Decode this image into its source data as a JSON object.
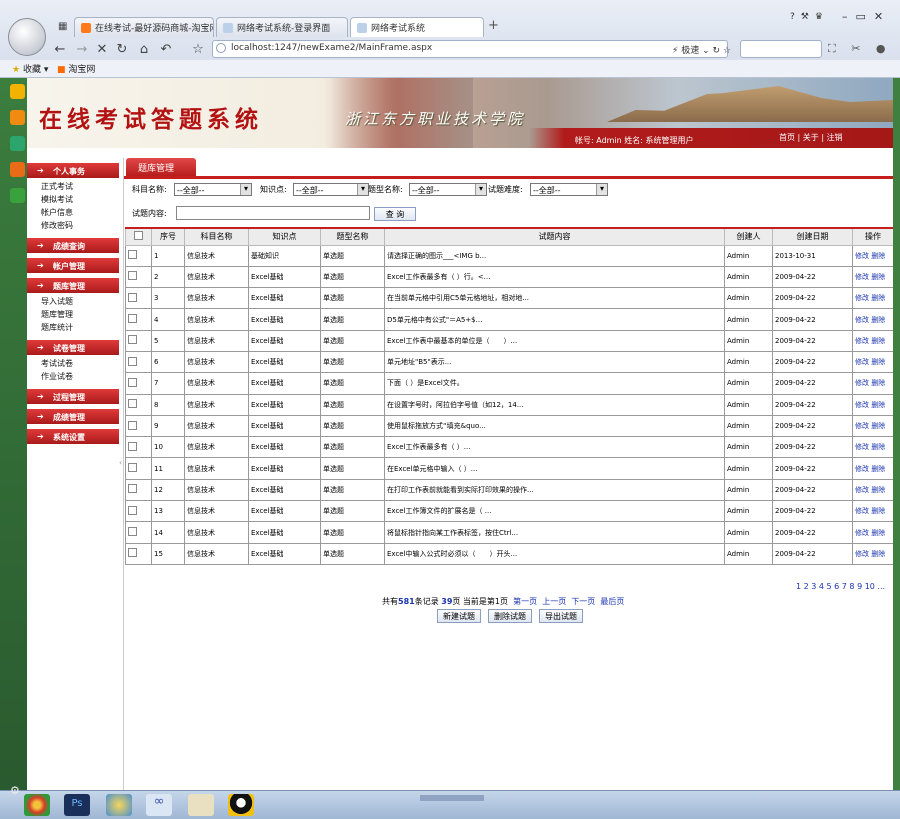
{
  "browser": {
    "tabs": [
      {
        "label": "在线考试-最好源码商城-淘宝网",
        "active": false
      },
      {
        "label": "网络考试系统-登录界面",
        "active": false
      },
      {
        "label": "网络考试系统",
        "active": true
      }
    ],
    "new_tab": "+",
    "address": "localhost:1247/newExame2/MainFrame.aspx",
    "speed_label": "极速",
    "bookmarks": [
      {
        "label": "收藏"
      },
      {
        "label": "淘宝网"
      }
    ]
  },
  "header": {
    "app_title": "在线考试答题系统",
    "school_name": "浙江东方职业技术学院",
    "user_info": "帐号: Admin 姓名: 系统管理用户",
    "links": [
      "首页",
      "关于",
      "注销"
    ]
  },
  "sidebar": {
    "groups": [
      {
        "label": "个人事务",
        "items": [
          "正式考试",
          "模拟考试",
          "帐户信息",
          "修改密码"
        ]
      },
      {
        "label": "成绩查询",
        "items": []
      },
      {
        "label": "帐户管理",
        "items": []
      },
      {
        "label": "题库管理",
        "items": [
          "导入试题",
          "题库管理",
          "题库统计"
        ]
      },
      {
        "label": "试卷管理",
        "items": [
          "考试试卷",
          "作业试卷"
        ]
      },
      {
        "label": "过程管理",
        "items": []
      },
      {
        "label": "成绩管理",
        "items": []
      },
      {
        "label": "系统设置",
        "items": []
      }
    ]
  },
  "panel": {
    "tab": "题库管理",
    "filters": {
      "subject_label": "科目名称:",
      "subject_value": "--全部--",
      "knowledge_label": "知识点:",
      "knowledge_value": "--全部--",
      "type_label": "题型名称:",
      "type_value": "--全部--",
      "difficulty_label": "试题难度:",
      "difficulty_value": "--全部--",
      "content_label": "试题内容:",
      "content_value": "",
      "query_button": "查 询"
    },
    "columns": [
      "",
      "序号",
      "科目名称",
      "知识点",
      "题型名称",
      "试题内容",
      "创建人",
      "创建日期",
      "操作"
    ],
    "rows": [
      [
        "1",
        "信息技术",
        "基础知识",
        "单选题",
        "请选择正确的图示___<IMG b...",
        "Admin",
        "2013-10-31"
      ],
      [
        "2",
        "信息技术",
        "Excel基础",
        "单选题",
        "Excel工作表最多有（ ）行。<...",
        "Admin",
        "2009-04-22"
      ],
      [
        "3",
        "信息技术",
        "Excel基础",
        "单选题",
        "在当前单元格中引用C5单元格地址，相对地...",
        "Admin",
        "2009-04-22"
      ],
      [
        "4",
        "信息技术",
        "Excel基础",
        "单选题",
        "D5单元格中有公式\"＝A5+$...",
        "Admin",
        "2009-04-22"
      ],
      [
        "5",
        "信息技术",
        "Excel基础",
        "单选题",
        "Excel工作表中最基本的单位是（　　）...",
        "Admin",
        "2009-04-22"
      ],
      [
        "6",
        "信息技术",
        "Excel基础",
        "单选题",
        "单元地址\"B5\"表示...",
        "Admin",
        "2009-04-22"
      ],
      [
        "7",
        "信息技术",
        "Excel基础",
        "单选题",
        "下面（ ）是Excel文件。",
        "Admin",
        "2009-04-22"
      ],
      [
        "8",
        "信息技术",
        "Excel基础",
        "单选题",
        "在设置字号时，阿拉伯字号值（如12，14...",
        "Admin",
        "2009-04-22"
      ],
      [
        "9",
        "信息技术",
        "Excel基础",
        "单选题",
        "使用鼠标拖放方式“填充&quo...",
        "Admin",
        "2009-04-22"
      ],
      [
        "10",
        "信息技术",
        "Excel基础",
        "单选题",
        "Excel工作表最多有（ ）...",
        "Admin",
        "2009-04-22"
      ],
      [
        "11",
        "信息技术",
        "Excel基础",
        "单选题",
        "在Excel单元格中输入（ ）...",
        "Admin",
        "2009-04-22"
      ],
      [
        "12",
        "信息技术",
        "Excel基础",
        "单选题",
        "在打印工作表前就能看到实际打印效果的操作...",
        "Admin",
        "2009-04-22"
      ],
      [
        "13",
        "信息技术",
        "Excel基础",
        "单选题",
        "Excel工作簿文件的扩展名是（ ...",
        "Admin",
        "2009-04-22"
      ],
      [
        "14",
        "信息技术",
        "Excel基础",
        "单选题",
        "将鼠标指针指向某工作表标签，按住Ctrl...",
        "Admin",
        "2009-04-22"
      ],
      [
        "15",
        "信息技术",
        "Excel基础",
        "单选题",
        "Excel中输入公式时必须以（　　）开头...",
        "Admin",
        "2009-04-22"
      ]
    ],
    "edit_label": "修改",
    "delete_label": "删除",
    "pagination": "1 2 3 4 5 6 7 8 9 10 ...",
    "summary": {
      "prefix": "共有",
      "total": "581",
      "mid1": "条记录 ",
      "pages": "39",
      "mid2": "页 当前是第1页",
      "first": "第一页",
      "prev": "上一页",
      "next": "下一页",
      "last": "最后页"
    },
    "actions": [
      "新建试题",
      "删除试题",
      "导出试题"
    ]
  }
}
